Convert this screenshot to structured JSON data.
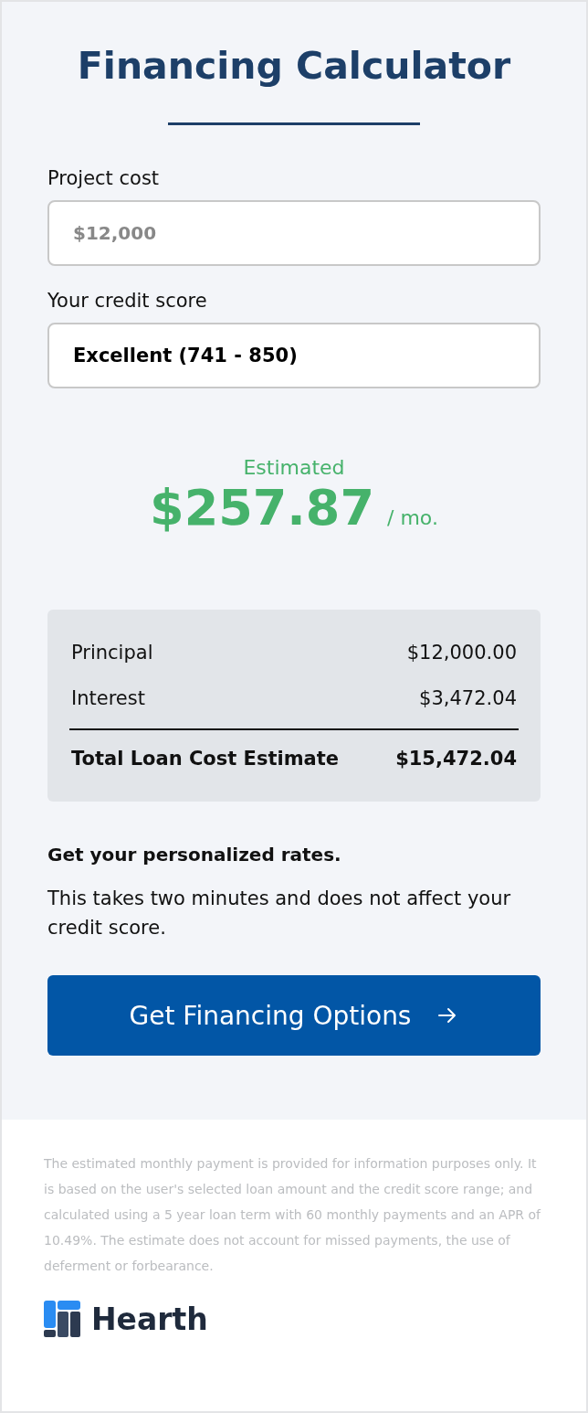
{
  "title": "Financing Calculator",
  "fields": [
    {
      "label": "Project cost",
      "kind": "input",
      "placeholder": "$12,000"
    },
    {
      "label": "Your credit score",
      "kind": "select",
      "value": "Excellent (741 - 850)"
    }
  ],
  "estimate": {
    "caption": "Estimated",
    "amount": "$257.87",
    "unit": "/ mo."
  },
  "breakdown": {
    "rows": [
      {
        "label": "Principal",
        "value": "$12,000.00"
      },
      {
        "label": "Interest",
        "value": "$3,472.04"
      }
    ],
    "total": {
      "label": "Total Loan Cost Estimate",
      "value": "$15,472.04"
    }
  },
  "cta": {
    "heading": "Get your personalized rates.",
    "body": "This takes two minutes and does not affect your credit score.",
    "button": "Get Financing Options"
  },
  "disclaimer": "The estimated monthly payment is provided for information purposes only. It is based on the user's selected loan amount and the credit score range; and calculated using a 5 year loan term with 60 monthly payments and an APR of 10.49%. The estimate does not account for missed payments, the use of deferment or forbearance.",
  "brand": "Hearth"
}
